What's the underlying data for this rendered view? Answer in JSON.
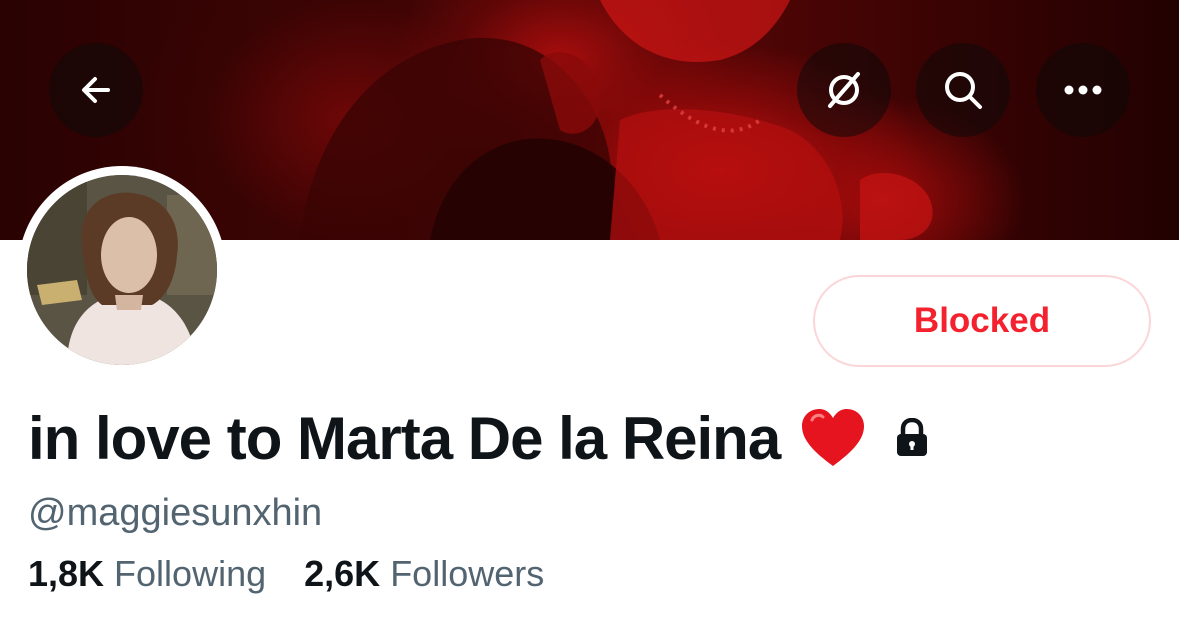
{
  "header": {
    "back_icon": "arrow-left-icon",
    "grok_icon": "grok-icon",
    "search_icon": "search-icon",
    "more_icon": "more-horizontal-icon"
  },
  "profile": {
    "display_name": "in love to Marta De la Reina",
    "name_emoji": "heart-icon",
    "protected_icon": "lock-icon",
    "handle": "@maggiesunxhin",
    "following_count": "1,8K",
    "following_label": "Following",
    "followers_count": "2,6K",
    "followers_label": "Followers"
  },
  "actions": {
    "blocked_label": "Blocked"
  },
  "colors": {
    "blocked_red": "#f4212e",
    "blocked_border": "#fbd6d9",
    "text_primary": "#0f1419",
    "text_secondary": "#536471"
  }
}
